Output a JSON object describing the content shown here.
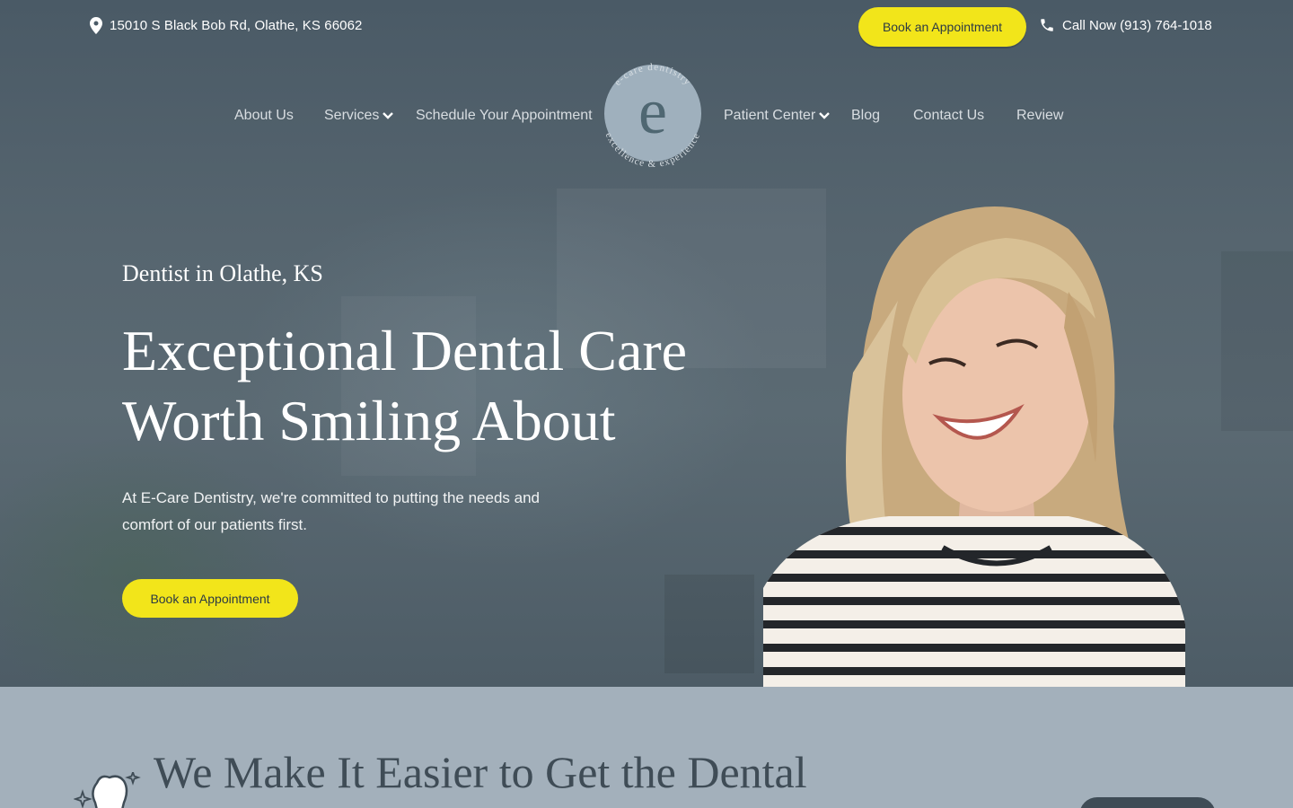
{
  "topbar": {
    "address": "15010 S Black Bob Rd, Olathe, KS 66062",
    "book_label": "Book an Appointment",
    "call_label": "Call Now (913) 764-1018"
  },
  "nav": {
    "items": [
      {
        "label": "About Us"
      },
      {
        "label": "Services"
      },
      {
        "label": "Schedule Your Appointment"
      },
      {
        "label": "Patient Center"
      },
      {
        "label": "Blog"
      },
      {
        "label": "Contact Us"
      },
      {
        "label": "Review"
      }
    ]
  },
  "logo": {
    "top_text": "e-care dentistry",
    "bottom_text": "excellence & experience",
    "letter": "e"
  },
  "hero": {
    "eyebrow": "Dentist in Olathe, KS",
    "headline_line1": "Exceptional Dental Care",
    "headline_line2": "Worth Smiling About",
    "lede": "At E-Care Dentistry, we're committed to putting the needs and comfort of our patients first.",
    "book_label": "Book an Appointment"
  },
  "section2": {
    "title": "We Make It Easier to Get the Dental"
  },
  "colors": {
    "accent": "#f2e51a",
    "slate": "#3f4c56",
    "band": "#a3b0bb"
  }
}
